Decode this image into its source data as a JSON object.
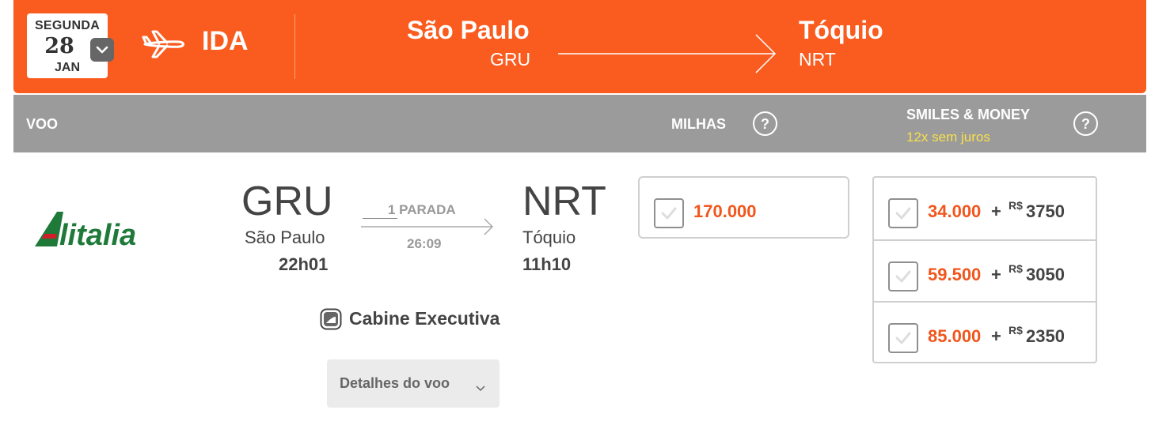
{
  "header": {
    "date": {
      "weekday": "SEGUNDA",
      "day": "28",
      "month": "JAN"
    },
    "direction": "IDA",
    "origin": {
      "city": "São Paulo",
      "code": "GRU"
    },
    "destination": {
      "city": "Tóquio",
      "code": "NRT"
    }
  },
  "columns": {
    "flight": "VOO",
    "miles": "MILHAS",
    "smiles_money": "SMILES & MONEY",
    "smiles_money_sub": "12x sem juros",
    "help": "?"
  },
  "flight": {
    "airline": "Alitalia",
    "origin_code": "GRU",
    "origin_city": "São Paulo",
    "departure_time": "22h01",
    "stops": "1 PARADA",
    "duration": "26:09",
    "dest_code": "NRT",
    "dest_city": "Tóquio",
    "arrival_time": "11h10",
    "cabin": "Cabine Executiva",
    "details_button": "Detalhes do voo"
  },
  "miles_option": {
    "miles": "170.000"
  },
  "smiles_options": [
    {
      "miles": "34.000",
      "plus": "+",
      "currency": "R$",
      "money": "3750"
    },
    {
      "miles": "59.500",
      "plus": "+",
      "currency": "R$",
      "money": "3050"
    },
    {
      "miles": "85.000",
      "plus": "+",
      "currency": "R$",
      "money": "2350"
    }
  ],
  "colors": {
    "brand_orange": "#fa5c1f",
    "header_gray": "#9b9b9b",
    "price_orange": "#f1561c",
    "highlight_yellow": "#f8e04a",
    "alitalia_green": "#1f7a3a",
    "alitalia_red": "#d11f2a"
  }
}
